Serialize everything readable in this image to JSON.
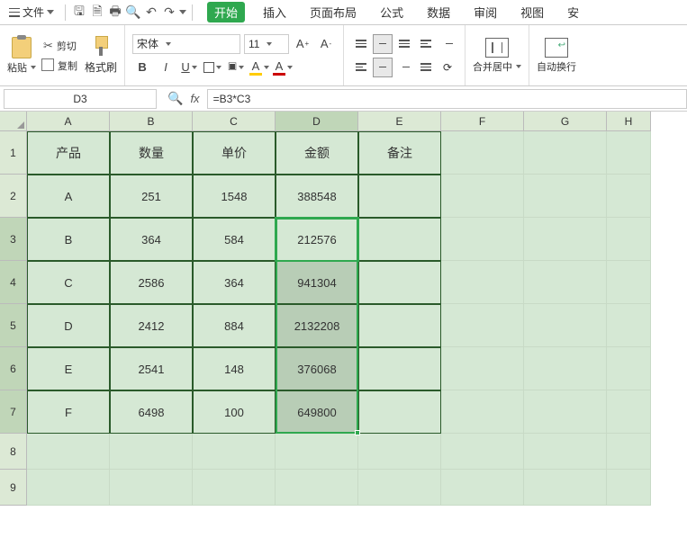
{
  "menubar": {
    "file_label": "文件",
    "tabs": [
      "开始",
      "插入",
      "页面布局",
      "公式",
      "数据",
      "审阅",
      "视图",
      "安"
    ]
  },
  "ribbon": {
    "paste_label": "粘贴",
    "cut_label": "剪切",
    "copy_label": "复制",
    "format_painter_label": "格式刷",
    "font_name": "宋体",
    "font_size": "11",
    "merge_label": "合并居中",
    "wrap_label": "自动换行"
  },
  "formula_bar": {
    "name_box": "D3",
    "formula": "=B3*C3"
  },
  "columns": [
    "A",
    "B",
    "C",
    "D",
    "E",
    "F",
    "G",
    "H"
  ],
  "rows": [
    "1",
    "2",
    "3",
    "4",
    "5",
    "6",
    "7",
    "8",
    "9"
  ],
  "table": {
    "headers": [
      "产品",
      "数量",
      "单价",
      "金额",
      "备注"
    ],
    "data": [
      {
        "product": "A",
        "qty": "251",
        "price": "1548",
        "amount": "388548",
        "remark": ""
      },
      {
        "product": "B",
        "qty": "364",
        "price": "584",
        "amount": "212576",
        "remark": ""
      },
      {
        "product": "C",
        "qty": "2586",
        "price": "364",
        "amount": "941304",
        "remark": ""
      },
      {
        "product": "D",
        "qty": "2412",
        "price": "884",
        "amount": "2132208",
        "remark": ""
      },
      {
        "product": "E",
        "qty": "2541",
        "price": "148",
        "amount": "376068",
        "remark": ""
      },
      {
        "product": "F",
        "qty": "6498",
        "price": "100",
        "amount": "649800",
        "remark": ""
      }
    ]
  },
  "selection": {
    "active_cell": "D3",
    "range": "D3:D7",
    "fill_range": "D4:D7"
  }
}
